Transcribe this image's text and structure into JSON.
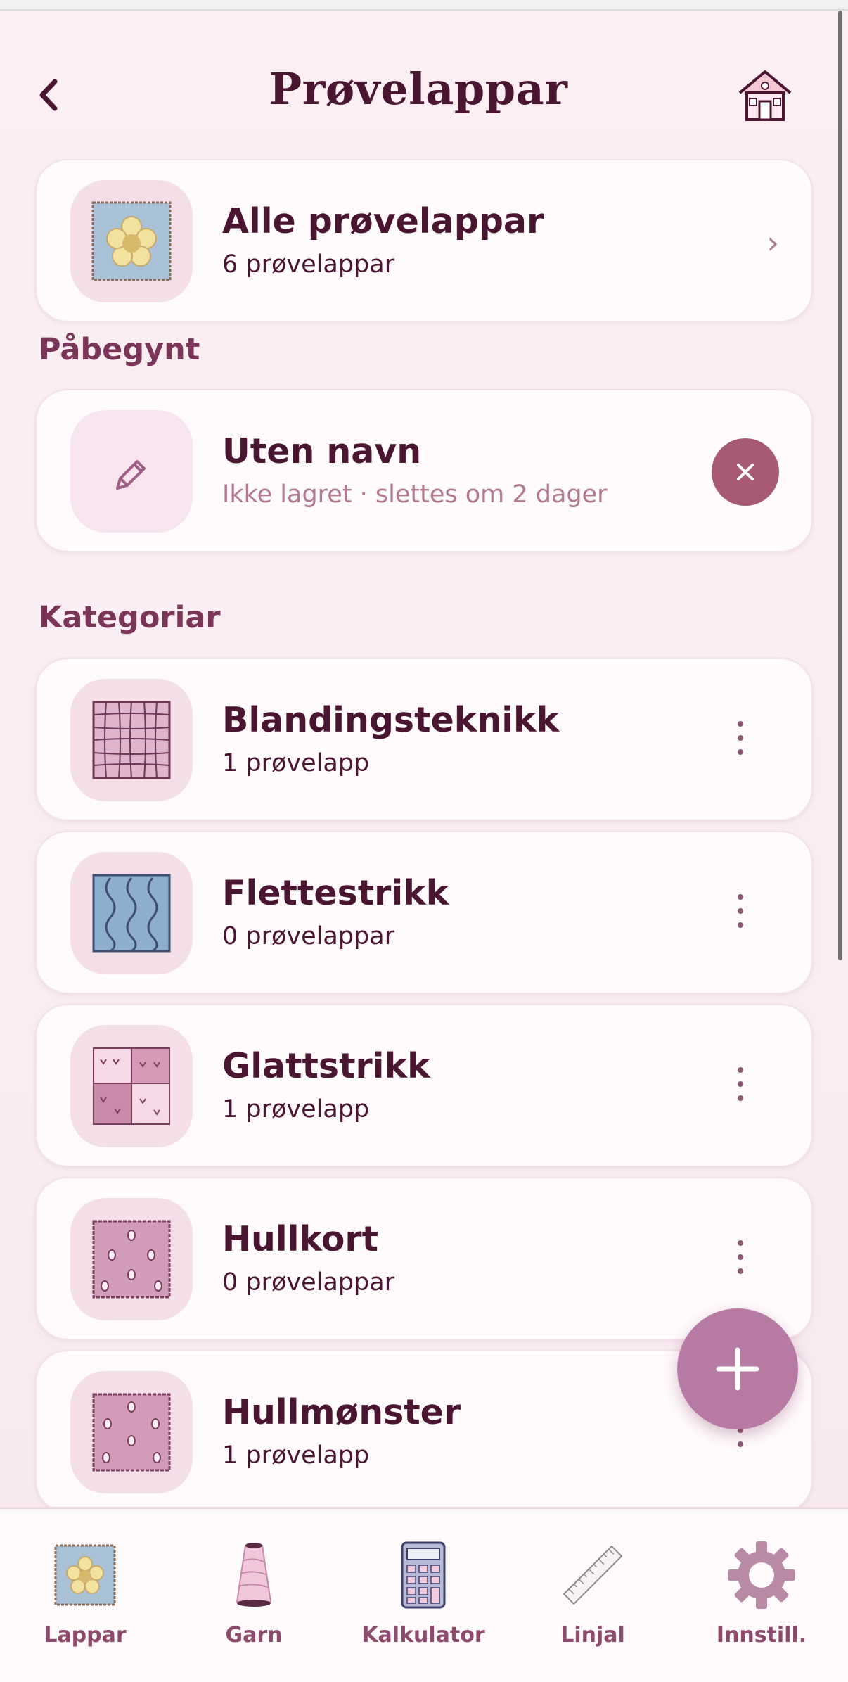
{
  "header": {
    "title": "Prøvelappar",
    "back_icon": "chevron-left-icon",
    "home_icon": "house-icon"
  },
  "all_card": {
    "title": "Alle prøvelappar",
    "subtitle": "6 prøvelappar"
  },
  "started": {
    "heading": "Påbegynt",
    "item": {
      "title": "Uten navn",
      "subtitle": "Ikke lagret · slettes om 2 dager",
      "icon": "pencil-icon",
      "delete_icon": "close-icon"
    }
  },
  "categories": {
    "heading": "Kategoriar",
    "items": [
      {
        "title": "Blandingsteknikk",
        "subtitle": "1 prøvelapp"
      },
      {
        "title": "Flettestrikk",
        "subtitle": "0 prøvelappar"
      },
      {
        "title": "Glattstrikk",
        "subtitle": "1 prøvelapp"
      },
      {
        "title": "Hullkort",
        "subtitle": "0 prøvelappar"
      },
      {
        "title": "Hullmønster",
        "subtitle": "1 prøvelapp"
      }
    ]
  },
  "tabbar": {
    "items": [
      {
        "label": "Lappar",
        "icon": "swatch-icon"
      },
      {
        "label": "Garn",
        "icon": "yarn-cone-icon"
      },
      {
        "label": "Kalkulator",
        "icon": "calculator-icon"
      },
      {
        "label": "Linjal",
        "icon": "ruler-icon"
      },
      {
        "label": "Innstill.",
        "icon": "gear-icon"
      }
    ]
  },
  "colors": {
    "accent": "#b77aa3",
    "title": "#4a1530",
    "section": "#7a3558",
    "delete": "#a85a74",
    "background": "#fbeff4"
  }
}
